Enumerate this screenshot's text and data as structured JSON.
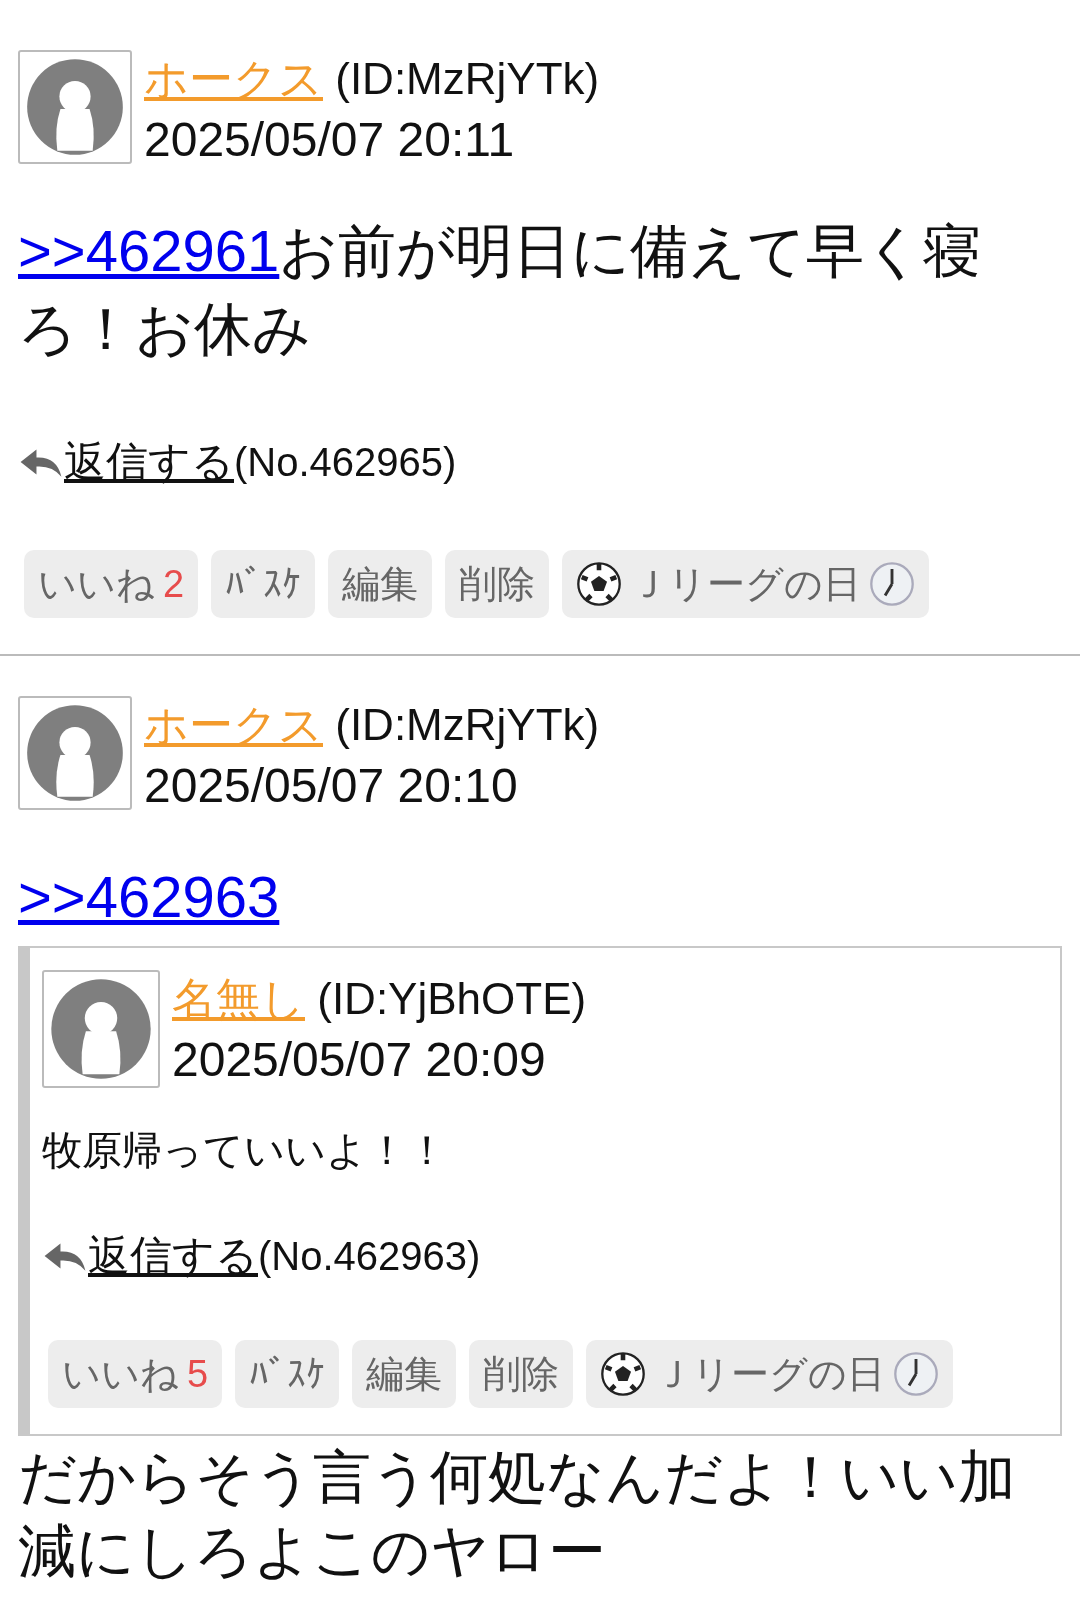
{
  "posts": [
    {
      "author": "ホークス",
      "user_id": "(ID:MzRjYTk)",
      "date": "2025/05/07 20:11",
      "anchor": ">>462961",
      "text": "お前が明日に備えて早く寝ろ！お休み",
      "reply_label": "返信する",
      "number": "(No.462965)",
      "buttons": [
        {
          "kind": "like",
          "label": "いいね",
          "count": "2"
        },
        {
          "kind": "plain",
          "label": "ﾊﾞｽｹ"
        },
        {
          "kind": "plain",
          "label": "編集"
        },
        {
          "kind": "plain",
          "label": "削除"
        },
        {
          "kind": "event",
          "label": "Ｊリーグの日"
        }
      ]
    },
    {
      "author": "ホークス",
      "user_id": "(ID:MzRjYTk)",
      "date": "2025/05/07 20:10",
      "anchor": ">>462963",
      "quote": {
        "author": "名無し",
        "user_id": "(ID:YjBhOTE)",
        "date": "2025/05/07 20:09",
        "text": "牧原帰っていいよ！！",
        "reply_label": "返信する",
        "number": "(No.462963)",
        "buttons": [
          {
            "kind": "like",
            "label": "いいね",
            "count": "5"
          },
          {
            "kind": "plain",
            "label": "ﾊﾞｽｹ"
          },
          {
            "kind": "plain",
            "label": "編集"
          },
          {
            "kind": "plain",
            "label": "削除"
          },
          {
            "kind": "event",
            "label": "Ｊリーグの日"
          }
        ]
      },
      "text": "だからそう言う何処なんだよ！いい加減にしろよこのヤロー"
    }
  ]
}
